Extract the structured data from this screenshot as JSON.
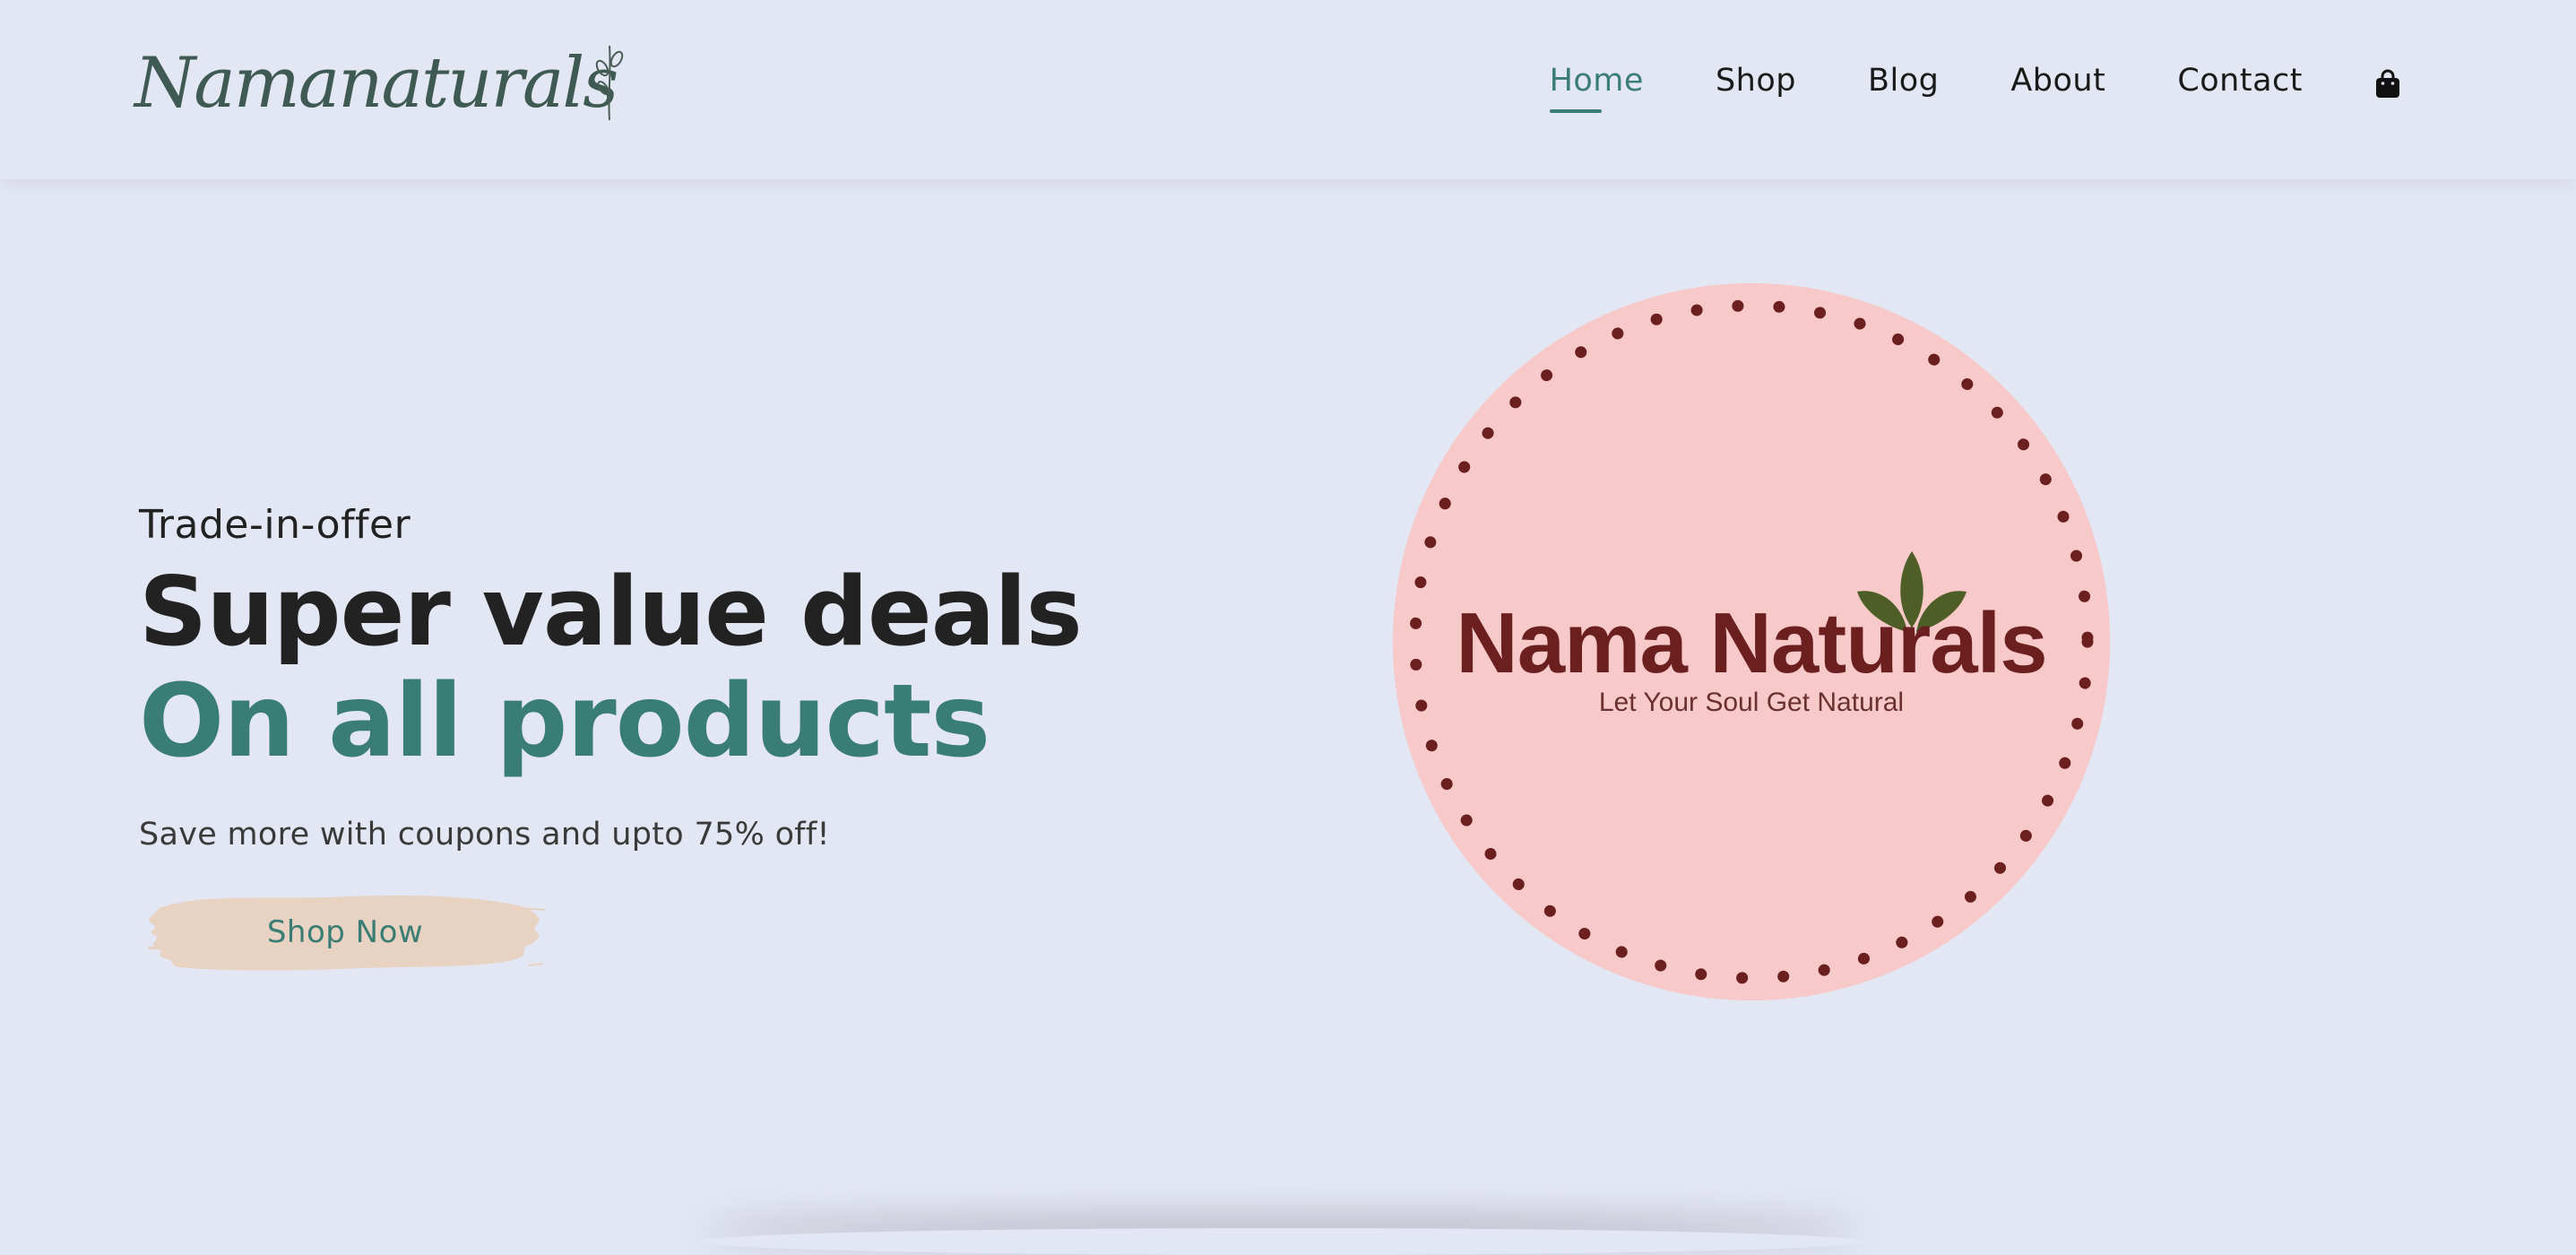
{
  "header": {
    "logo_text": "Namanaturals",
    "nav": [
      {
        "label": "Home",
        "active": true
      },
      {
        "label": "Shop"
      },
      {
        "label": "Blog"
      },
      {
        "label": "About"
      },
      {
        "label": "Contact"
      }
    ],
    "cart_icon": "shopping-bag-icon"
  },
  "hero": {
    "kicker": "Trade-in-offer",
    "headline": "Super value deals",
    "headline_accent": "On all products",
    "subtext": "Save more with coupons and upto 75% off!",
    "cta_label": "Shop Now"
  },
  "badge": {
    "title": "Nama Naturals",
    "tagline": "Let Your Soul Get Natural"
  },
  "colors": {
    "background": "#e3e6f3",
    "accent": "#3a7d74",
    "badge_fill": "#f7c9c9",
    "badge_text": "#6b1f1f",
    "leaf": "#4e5e26",
    "button_brush": "#e8d2c2"
  }
}
